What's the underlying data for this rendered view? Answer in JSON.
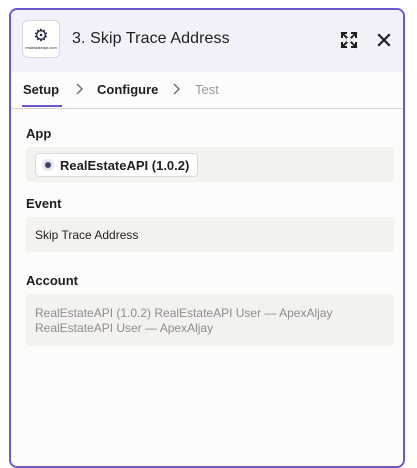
{
  "header": {
    "title": "3. Skip Trace Address",
    "app_icon_caption": "realestateapi.com",
    "app_icon": "realestateapi-gear-logo",
    "expand_icon": "expand-icon",
    "close_icon": "close-icon"
  },
  "tabs": [
    {
      "label": "Setup",
      "active": true
    },
    {
      "label": "Configure",
      "active": false
    },
    {
      "label": "Test",
      "active": false
    }
  ],
  "sections": {
    "app": {
      "label": "App",
      "value": "RealEstateAPI (1.0.2)"
    },
    "event": {
      "label": "Event",
      "value": "Skip Trace Address"
    },
    "account": {
      "label": "Account",
      "line1": "RealEstateAPI (1.0.2) RealEstateAPI User — ApexAljay",
      "line2": "RealEstateAPI User — ApexAljay"
    }
  },
  "colors": {
    "accent": "#6f57c9",
    "header_bg": "#f2f1f9",
    "field_bg": "#f4f2ef",
    "muted_text": "#8e8b90"
  }
}
